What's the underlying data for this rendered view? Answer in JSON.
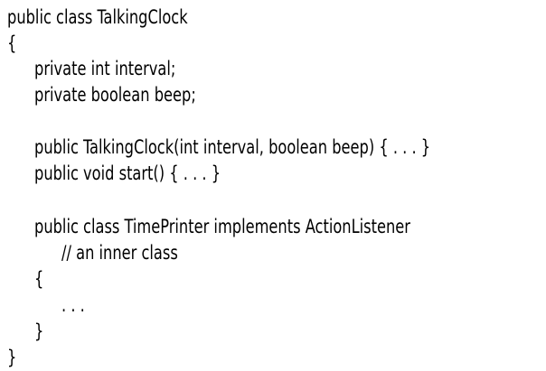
{
  "code": {
    "lines": [
      "public class TalkingClock",
      "{",
      "private int interval;",
      "private boolean beep;",
      "public TalkingClock(int interval, boolean beep) { . . . }",
      "public void start() { . . . }",
      "public class TimePrinter implements ActionListener",
      "// an inner class",
      "{",
      ". . .",
      "}",
      "}"
    ]
  }
}
